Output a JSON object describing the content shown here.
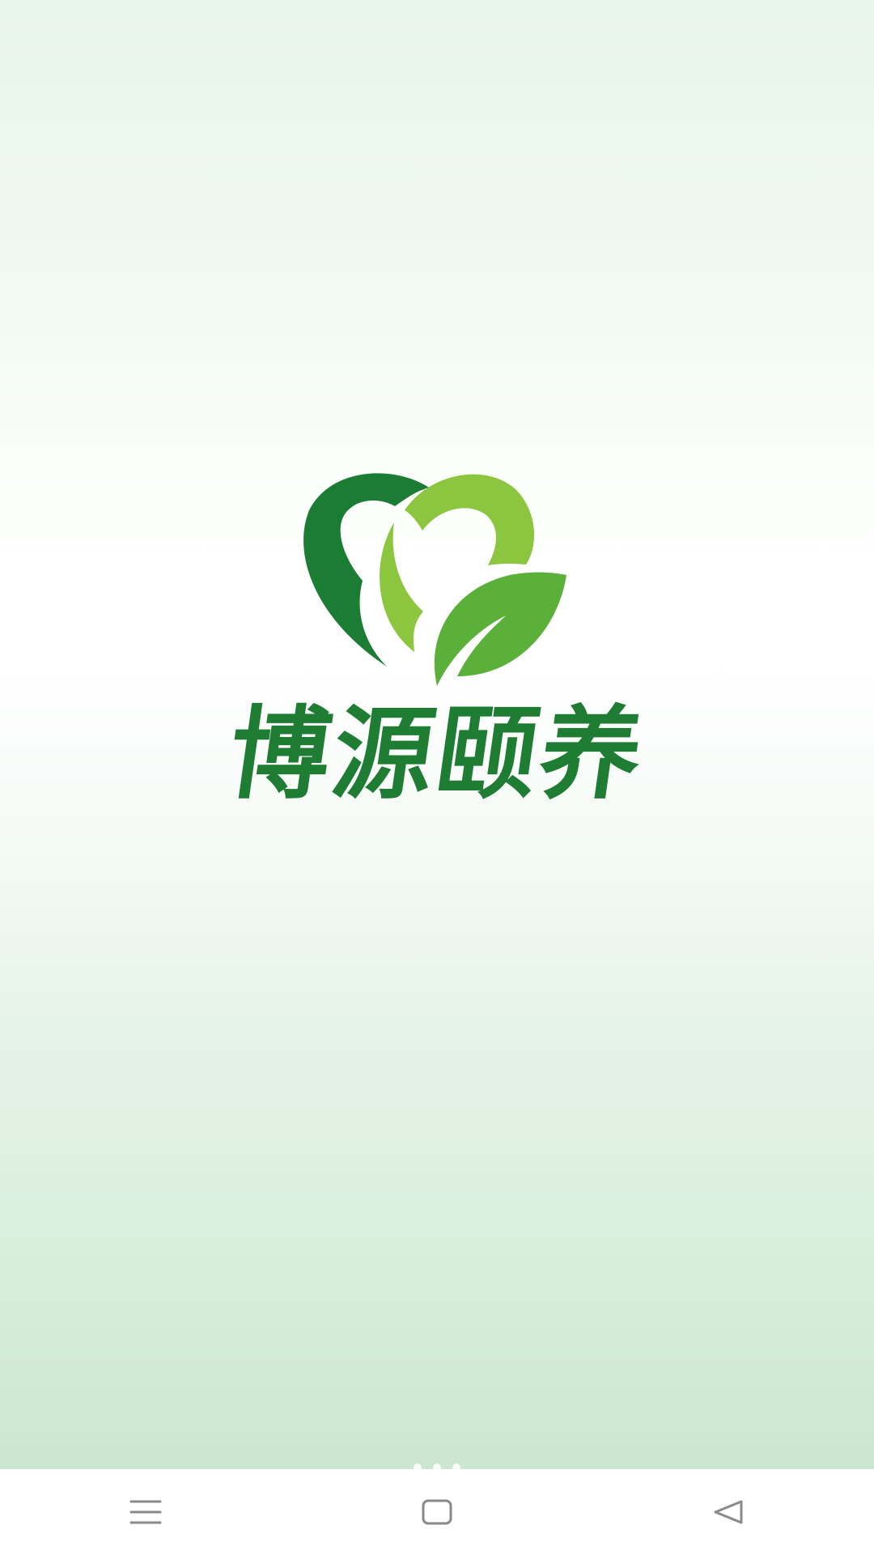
{
  "splash": {
    "brand_name": "博源颐养",
    "logo_icon": "heart-leaf-logo",
    "colors": {
      "dark_green": "#1b7d34",
      "lime_green": "#8cc63f",
      "leaf_green": "#5bb03a",
      "text_green": "#1f7d33"
    }
  },
  "pager": {
    "count": 3,
    "active_index": 0
  },
  "navbar": {
    "menu_icon": "menu-icon",
    "home_icon": "home-square-icon",
    "back_icon": "back-triangle-icon"
  }
}
